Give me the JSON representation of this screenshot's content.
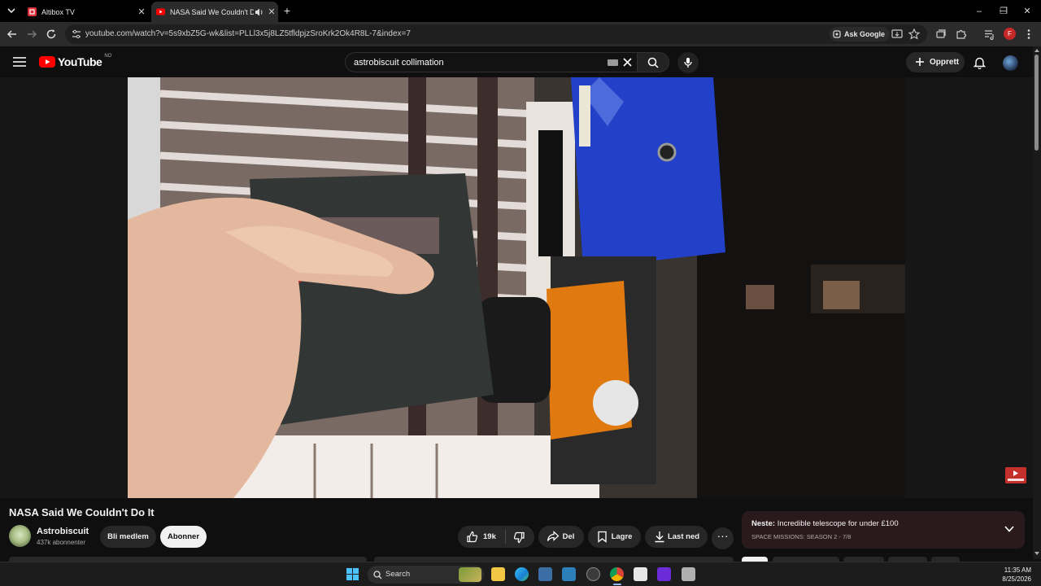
{
  "browser": {
    "tabs": [
      {
        "title": "Altibox TV"
      },
      {
        "title": "NASA Said We Couldn't Do It"
      }
    ],
    "url": "youtube.com/watch?v=5s9xbZ5G-wk&list=PLLl3x5j8LZ5tfldpjzSroKrk2Ok4R8L-7&index=7",
    "ask_google": "Ask Google",
    "profile_initial": "F"
  },
  "youtube": {
    "logo_text": "YouTube",
    "region": "NO",
    "search_query": "astrobiscuit collimation",
    "create_label": "Opprett"
  },
  "video": {
    "title": "NASA Said We Couldn't Do It",
    "channel": "Astrobiscuit",
    "subscribers": "437k abonnenter",
    "join_label": "Bli medlem",
    "subscribe_label": "Abonner",
    "likes": "19k",
    "share_label": "Del",
    "save_label": "Lagre",
    "download_label": "Last ned"
  },
  "next_up": {
    "prefix": "Neste:",
    "title": "Incredible telescope for under £100",
    "playlist": "SPACE MISSIONS: SEASON 2 - 7/8"
  },
  "taskbar": {
    "search_label": "Search",
    "time": "11:35 AM",
    "date": "8/25/2026"
  },
  "colors": {
    "youtube_red": "#ff0000",
    "next_card_bg": "#2b1a1d",
    "active_tab": "#2b2b2b"
  }
}
